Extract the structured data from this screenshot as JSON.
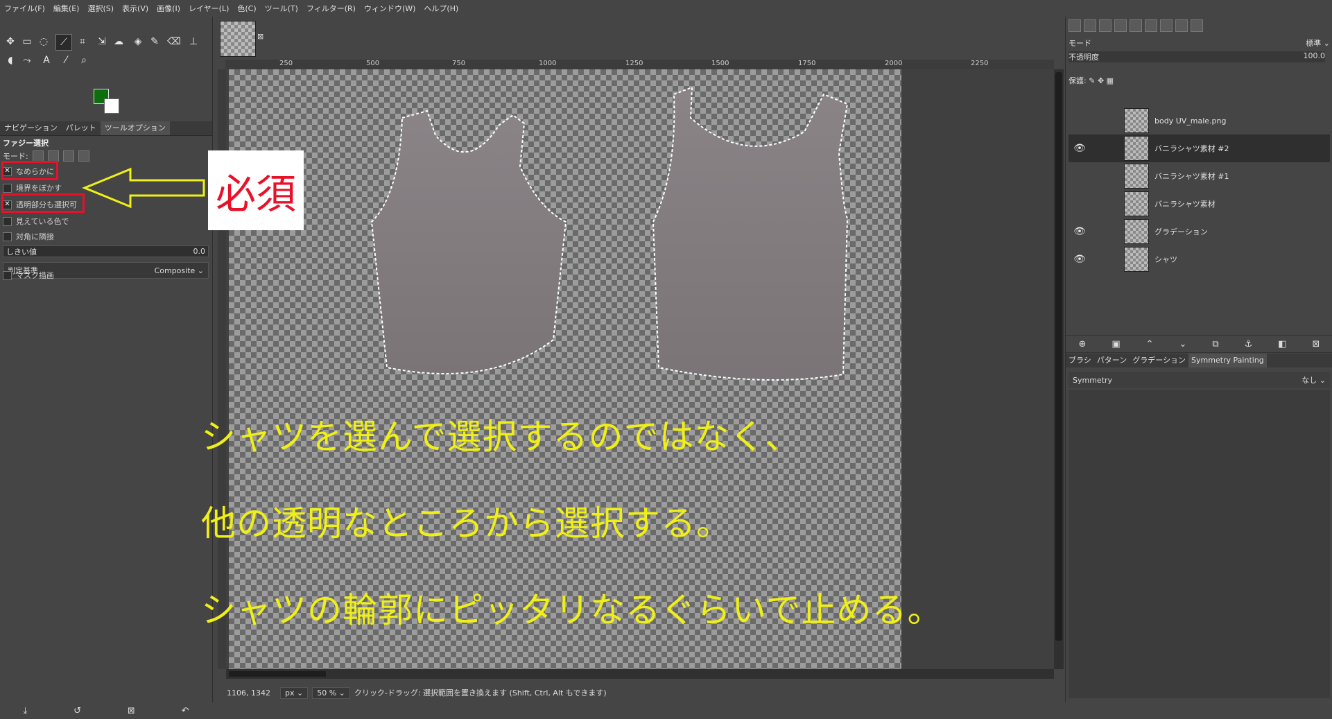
{
  "menu": [
    "ファイル(F)",
    "編集(E)",
    "選択(S)",
    "表示(V)",
    "画像(I)",
    "レイヤー(L)",
    "色(C)",
    "ツール(T)",
    "フィルター(R)",
    "ウィンドウ(W)",
    "ヘルプ(H)"
  ],
  "colors": {
    "foreground": "#0c6e0c",
    "background": "#ffffff",
    "annotation_red": "#e8112a",
    "overlay_yellow": "#f0f016"
  },
  "tools": [
    "move-icon",
    "rect-select-icon",
    "lasso-icon",
    "fuzzy-select-icon",
    "crop-icon",
    "transform-icon",
    "warp-icon",
    "bucket-fill-icon",
    "paintbrush-icon",
    "eraser-icon",
    "clone-icon",
    "smudge-icon",
    "paths-icon",
    "text-icon",
    "color-picker-icon",
    "zoom-icon"
  ],
  "left_dock": {
    "tabs": [
      "ナビゲーション",
      "パレット",
      "ツールオプション"
    ],
    "tool_title": "ファジー選択",
    "mode_label": "モード:",
    "options": [
      {
        "label": "なめらかに",
        "checked": true
      },
      {
        "label": "境界をぼかす",
        "checked": false
      },
      {
        "label": "透明部分も選択可",
        "checked": true
      },
      {
        "label": "見えている色で",
        "checked": false
      },
      {
        "label": "対角に隣接",
        "checked": false
      }
    ],
    "threshold_label": "しきい値",
    "threshold_value": "0.0",
    "criterion_label": "判定基準",
    "criterion_value": "Composite",
    "mask_label": "マスク描画"
  },
  "annotation": {
    "required_label": "必須"
  },
  "ruler_ticks": [
    "250",
    "500",
    "750",
    "1000",
    "1250",
    "1500",
    "1750",
    "2000",
    "2250"
  ],
  "overlay_lines": [
    "シャツを選んで選択するのではなく、",
    "他の透明なところから選択する。",
    "シャツの輪郭にピッタリなるぐらいで止める。"
  ],
  "status": {
    "coords": "1106, 1342",
    "unit": "px",
    "zoom": "50 %",
    "message": "クリック-ドラッグ: 選択範囲を置き換えます (Shift, Ctrl, Alt もできます)"
  },
  "right_panel": {
    "mode_label": "モード",
    "mode_value": "標準",
    "opacity_label": "不透明度",
    "opacity_value": "100.0",
    "lock_label": "保護:",
    "layers": [
      {
        "name": "body UV_male.png",
        "visible": false,
        "selected": false
      },
      {
        "name": "バニラシャツ素材 #2",
        "visible": true,
        "selected": true
      },
      {
        "name": "バニラシャツ素材 #1",
        "visible": false,
        "selected": false
      },
      {
        "name": "バニラシャツ素材",
        "visible": false,
        "selected": false
      },
      {
        "name": "グラデーション",
        "visible": true,
        "selected": false
      },
      {
        "name": "シャツ",
        "visible": true,
        "selected": false
      }
    ],
    "bottom_tabs": [
      "ブラシ",
      "パターン",
      "グラデーション",
      "Symmetry Painting"
    ],
    "symmetry_label": "Symmetry",
    "symmetry_value": "なし"
  }
}
